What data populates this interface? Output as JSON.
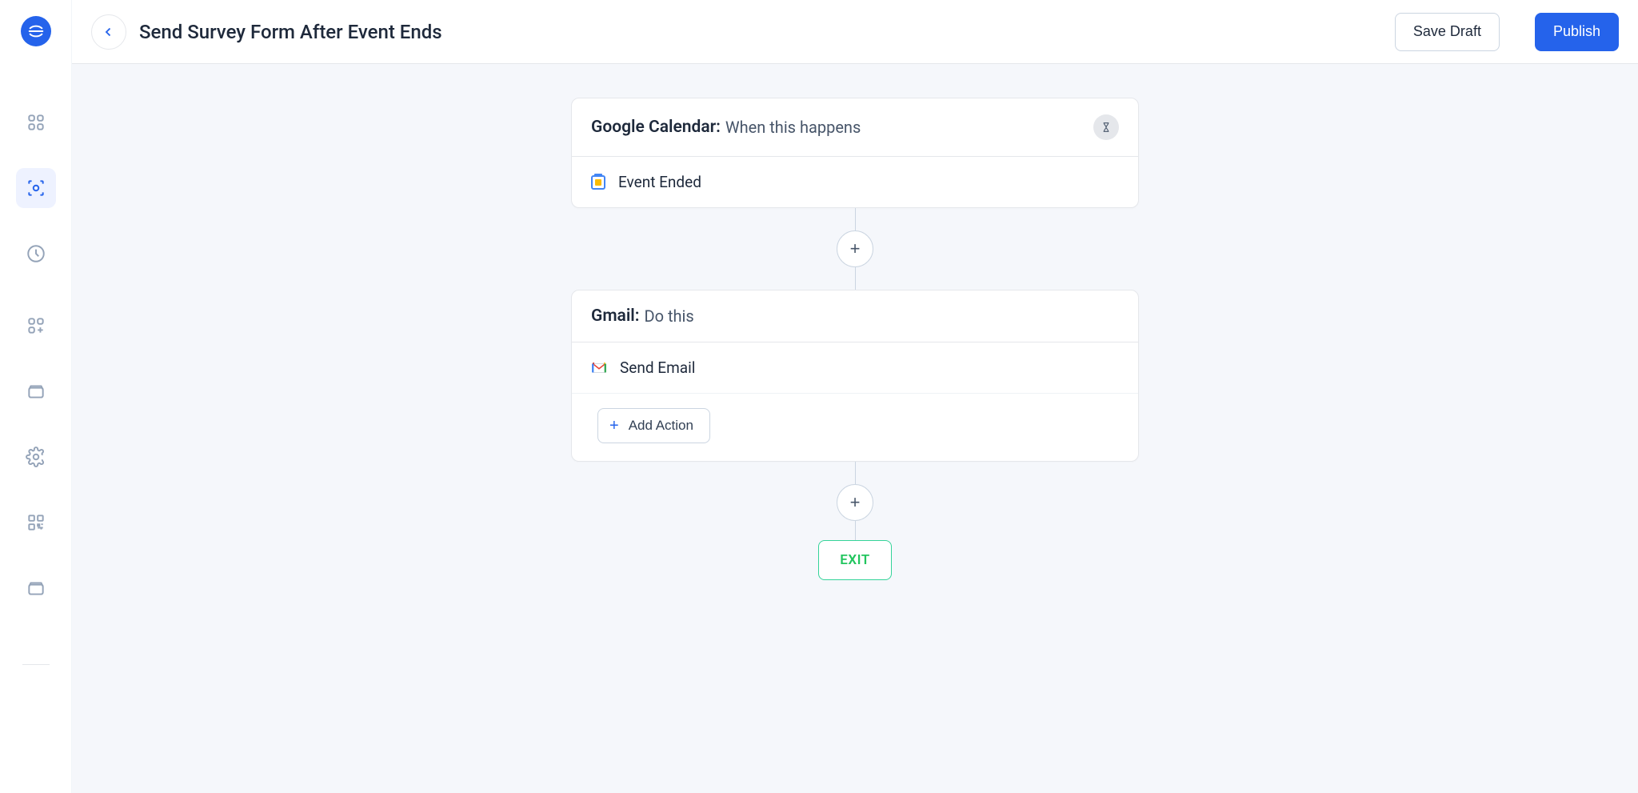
{
  "header": {
    "title": "Send Survey Form After Event Ends",
    "save_draft_label": "Save Draft",
    "publish_label": "Publish"
  },
  "trigger": {
    "service_label": "Google Calendar:",
    "subtitle": "When this happens",
    "event_label": "Event Ended"
  },
  "action": {
    "service_label": "Gmail:",
    "subtitle": "Do this",
    "event_label": "Send Email",
    "add_action_label": "Add Action"
  },
  "exit_label": "EXIT"
}
